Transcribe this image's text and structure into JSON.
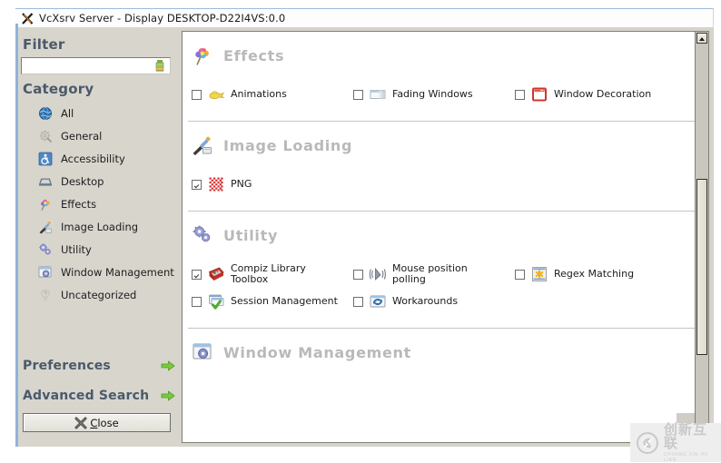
{
  "window": {
    "title": "VcXsrv Server - Display DESKTOP-D22I4VS:0.0",
    "logo_icon": "x-logo-icon",
    "accent_border": "#8fb3d9",
    "titlebar_bg": "#fdfdfd",
    "body_bg": "#d6d3cb",
    "panel_bg": "#ffffff"
  },
  "sidebar": {
    "filter_heading": "Filter",
    "filter": {
      "value": "",
      "placeholder": "",
      "clear_icon": "clear-filter-icon"
    },
    "category_heading": "Category",
    "items": [
      {
        "label": "All",
        "icon": "globe-icon",
        "name": "sidebar-item-all"
      },
      {
        "label": "General",
        "icon": "gear-outline-icon",
        "name": "sidebar-item-general"
      },
      {
        "label": "Accessibility",
        "icon": "accessibility-icon",
        "name": "sidebar-item-accessibility"
      },
      {
        "label": "Desktop",
        "icon": "desktop-icon",
        "name": "sidebar-item-desktop"
      },
      {
        "label": "Effects",
        "icon": "effects-icon",
        "name": "sidebar-item-effects"
      },
      {
        "label": "Image Loading",
        "icon": "image-loading-icon",
        "name": "sidebar-item-image-loading"
      },
      {
        "label": "Utility",
        "icon": "utility-gears-icon",
        "name": "sidebar-item-utility"
      },
      {
        "label": "Window Management",
        "icon": "window-management-icon",
        "name": "sidebar-item-window-management"
      },
      {
        "label": "Uncategorized",
        "icon": "question-bulb-icon",
        "name": "sidebar-item-uncategorized"
      }
    ],
    "preferences_label": "Preferences",
    "preferences_icon": "green-arrow-right-icon",
    "advanced_search_label": "Advanced Search",
    "advanced_search_icon": "green-arrow-right-icon",
    "close_button": {
      "label_prefix": "",
      "label_accel": "C",
      "label_rest": "lose",
      "full_label": "Close",
      "icon": "close-x-icon"
    }
  },
  "main": {
    "sections": [
      {
        "title": "Effects",
        "icon": "effects-icon",
        "plugins": [
          {
            "label": "Animations",
            "icon": "animations-lamp-icon",
            "checked": false
          },
          {
            "label": "Fading Windows",
            "icon": "fading-windows-icon",
            "checked": false
          },
          {
            "label": "Window Decoration",
            "icon": "window-decoration-icon",
            "checked": false
          }
        ]
      },
      {
        "title": "Image Loading",
        "icon": "image-loading-icon",
        "plugins": [
          {
            "label": "PNG",
            "icon": "png-icon",
            "checked": true
          }
        ]
      },
      {
        "title": "Utility",
        "icon": "utility-gears-icon",
        "plugins": [
          {
            "label": "Compiz Library Toolbox",
            "icon": "compiz-toolbox-icon",
            "checked": true
          },
          {
            "label": "Mouse position polling",
            "icon": "mouse-polling-icon",
            "checked": false
          },
          {
            "label": "Regex Matching",
            "icon": "regex-matching-icon",
            "checked": false
          },
          {
            "label": "Session Management",
            "icon": "session-management-icon",
            "checked": false
          },
          {
            "label": "Workarounds",
            "icon": "workarounds-icon",
            "checked": false
          }
        ]
      },
      {
        "title": "Window Management",
        "icon": "window-management-icon",
        "plugins": []
      }
    ]
  },
  "scrollbar": {
    "up_arrow_icon": "scroll-up-arrow-icon",
    "orientation": "vertical"
  },
  "watermark": {
    "chinese": "创新互联",
    "pinyin": "CHUANG XIN HU LIAN",
    "mark_icon": "cx-logo-icon"
  }
}
